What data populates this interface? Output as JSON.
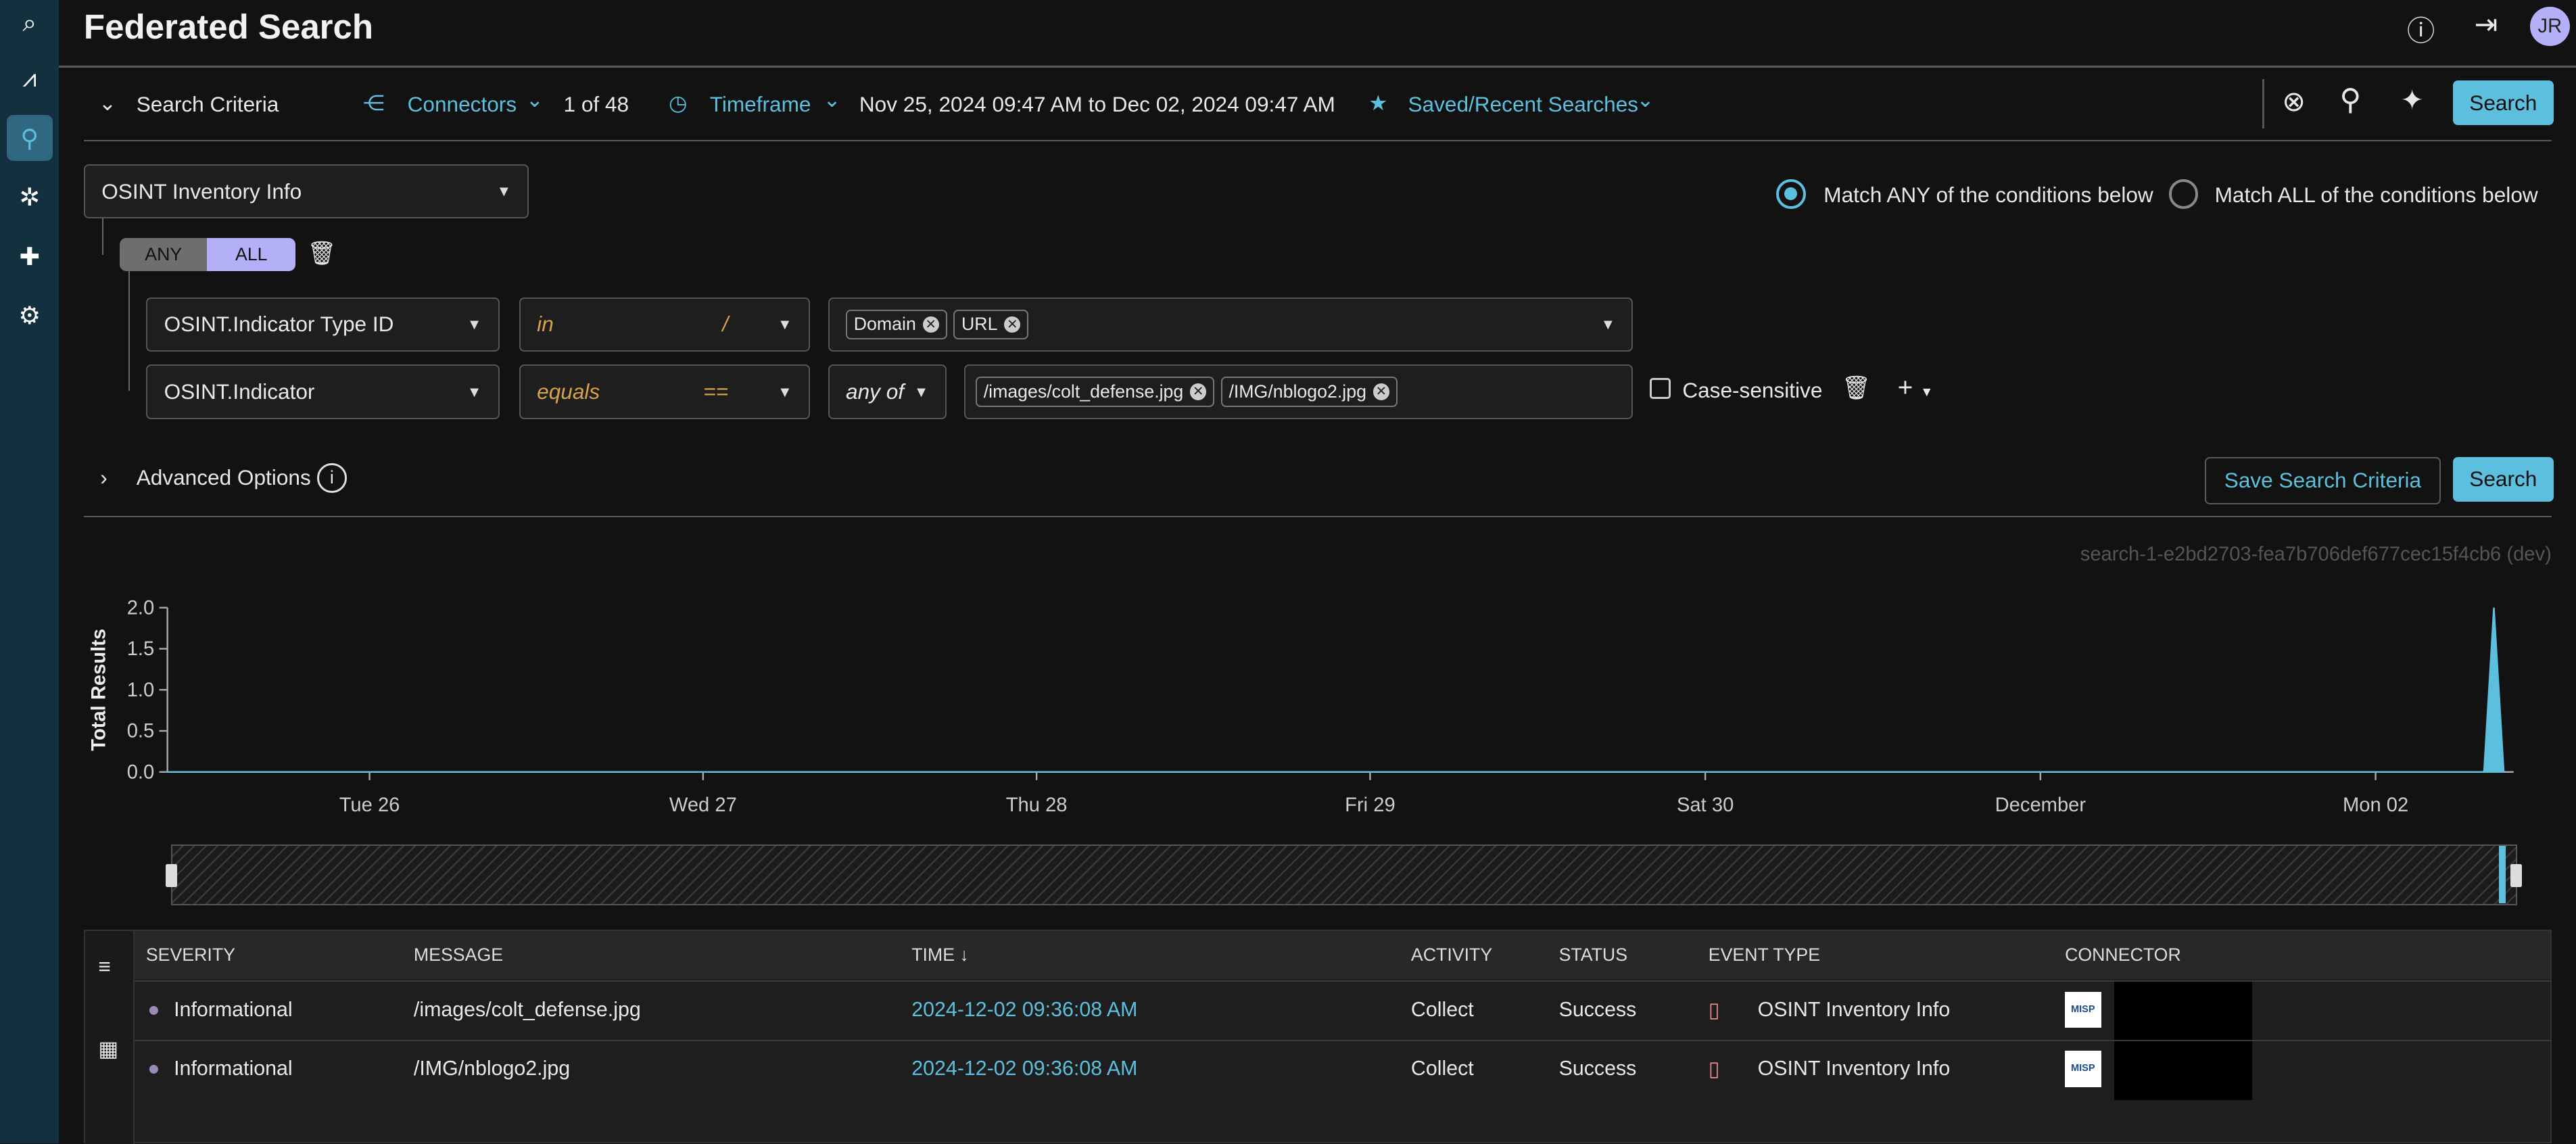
{
  "app": {
    "title": "Federated Search",
    "user_initials": "JR",
    "accent": "#5bbfdd",
    "avatar_color": "#b3b0f7"
  },
  "sidebar": {
    "items": [
      {
        "icon": "logo-icon"
      },
      {
        "icon": "analytics-icon"
      },
      {
        "icon": "search-icon",
        "active": true
      },
      {
        "icon": "network-icon"
      },
      {
        "icon": "puzzle-icon"
      },
      {
        "icon": "gear-icon"
      }
    ]
  },
  "toolbar": {
    "search_criteria": "Search Criteria",
    "connectors": "Connectors",
    "connectors_count": "1 of 48",
    "timeframe": "Timeframe",
    "timeframe_value": "Nov 25, 2024 09:47 AM to Dec 02, 2024 09:47 AM",
    "saved": "Saved/Recent Searches",
    "search": "Search"
  },
  "criteria": {
    "event_type": "OSINT Inventory Info",
    "any": "ANY",
    "all": "ALL",
    "match_any": "Match ANY of the conditions below",
    "match_all": "Match ALL of the conditions below",
    "match_selected": "any",
    "conditions": [
      {
        "field": "OSINT.Indicator Type ID",
        "operator": "in",
        "symbol": "/",
        "values": [
          "Domain",
          "URL"
        ]
      },
      {
        "field": "OSINT.Indicator",
        "operator": "equals",
        "symbol": "==",
        "quantifier": "any of",
        "values": [
          "/images/colt_defense.jpg",
          "/IMG/nblogo2.jpg"
        ],
        "case_sensitive": "Case-sensitive"
      }
    ]
  },
  "advanced": {
    "label": "Advanced Options",
    "save": "Save Search Criteria",
    "search": "Search"
  },
  "search_id": "search-1-e2bd2703-fea7b706def677cec15f4cb6 (dev)",
  "chart_data": {
    "type": "area",
    "ylabel": "Total Results",
    "ylim": [
      0,
      2
    ],
    "yticks": [
      "0.0",
      "0.5",
      "1.0",
      "1.5",
      "2.0"
    ],
    "xticks": [
      "Tue 26",
      "Wed 27",
      "Thu 28",
      "Fri 29",
      "Sat 30",
      "December",
      "Mon 02"
    ],
    "x": [
      "2024-11-25 09:47",
      "2024-12-02 09:30",
      "2024-12-02 09:36",
      "2024-12-02 09:42"
    ],
    "values": [
      0,
      0,
      2,
      0
    ],
    "color": "#5bbfdd",
    "grid": false
  },
  "table": {
    "columns": [
      "SEVERITY",
      "MESSAGE",
      "TIME",
      "ACTIVITY",
      "STATUS",
      "EVENT TYPE",
      "CONNECTOR"
    ],
    "rows": [
      {
        "severity": "Informational",
        "message": "/images/colt_defense.jpg",
        "time": "2024-12-02 09:36:08 AM",
        "activity": "Collect",
        "status": "Success",
        "event_type": "OSINT Inventory Info",
        "connector_logo": "MISP"
      },
      {
        "severity": "Informational",
        "message": "/IMG/nblogo2.jpg",
        "time": "2024-12-02 09:36:08 AM",
        "activity": "Collect",
        "status": "Success",
        "event_type": "OSINT Inventory Info",
        "connector_logo": "MISP"
      }
    ]
  }
}
